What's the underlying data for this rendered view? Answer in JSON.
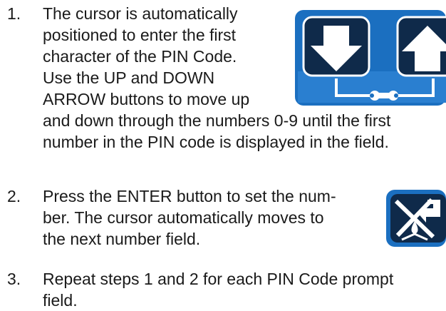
{
  "steps": [
    {
      "number": "1.",
      "lines": [
        "The cursor is automatically",
        "positioned to enter the first",
        "character of the PIN Code.",
        "Use the UP and DOWN",
        "ARROW buttons to move up",
        "and down through the numbers 0-9 until the first",
        "number in the PIN code is displayed in the field."
      ]
    },
    {
      "number": "2.",
      "lines": [
        "Press the ENTER button to set the num-",
        "ber. The cursor automatically moves to",
        "the next number field."
      ]
    },
    {
      "number": "3.",
      "lines": [
        "Repeat steps 1 and 2 for each PIN Code prompt",
        "field."
      ]
    }
  ],
  "icons": {
    "arrow_buttons": "down-and-up-arrow-buttons-with-wrench-icon",
    "enter_button": "enter-button-icon"
  },
  "colors": {
    "icon_blue": "#1b6fc0",
    "icon_dark": "#0f2a4a",
    "enter_bg": "#1d3a5f"
  }
}
